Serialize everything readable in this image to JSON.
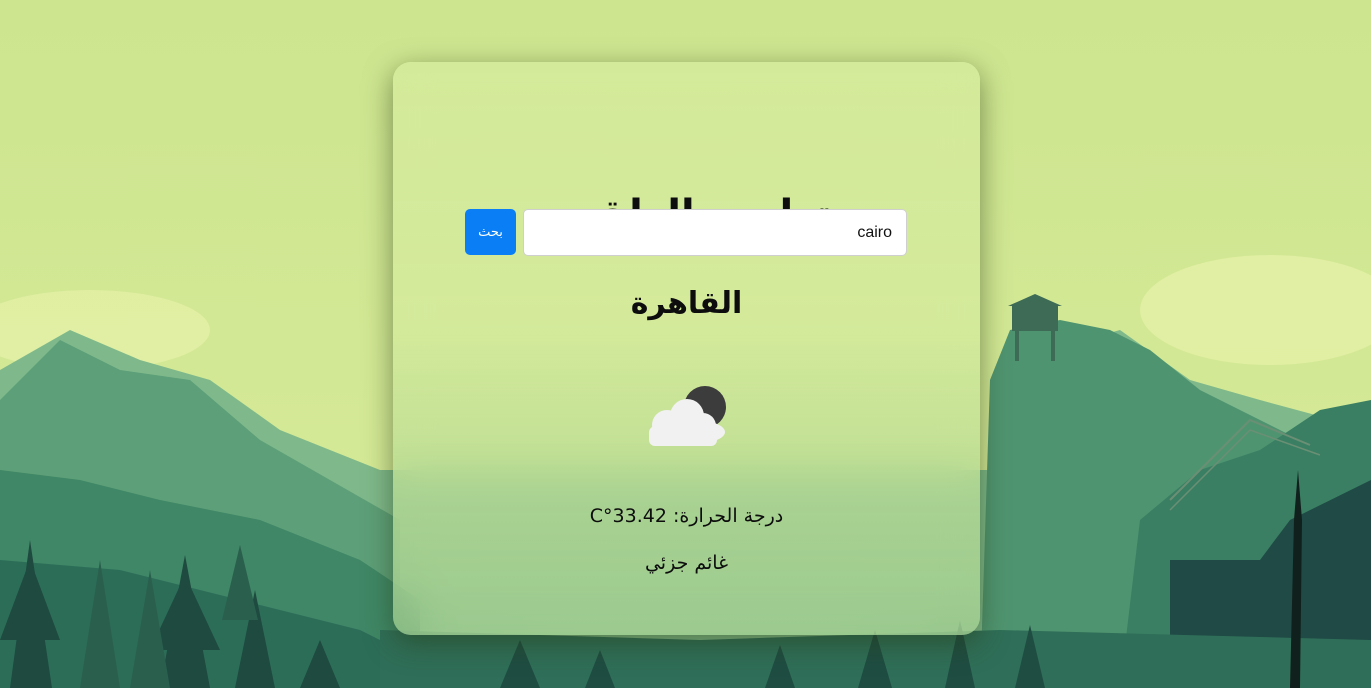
{
  "app": {
    "title": "تطبيق الطقس"
  },
  "search": {
    "value": "cairo",
    "button_label": "بحث"
  },
  "weather": {
    "city": "القاهرة",
    "icon": "partly-cloudy-night-icon",
    "temperature_label": "درجة الحرارة: 33.42°C",
    "description": "غائم جزئي"
  },
  "colors": {
    "accent": "#0a7ff5",
    "background_sky": "#c9e38b",
    "card_tint": "#d4ea9b"
  }
}
